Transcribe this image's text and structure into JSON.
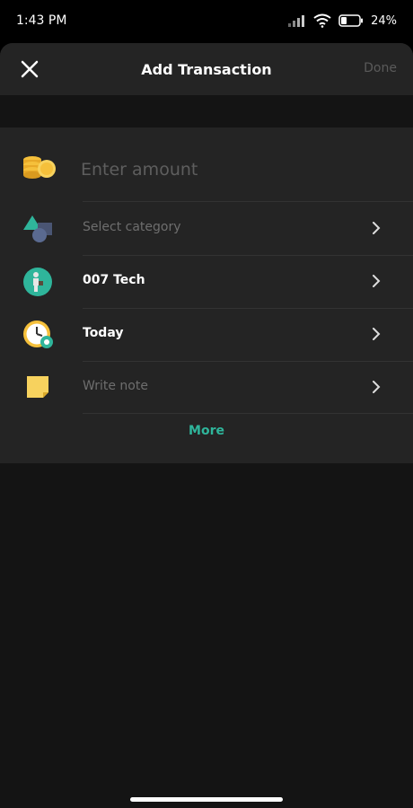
{
  "status_bar": {
    "time": "1:43 PM",
    "battery": "24%",
    "icons": [
      "signal-icon",
      "wifi-icon",
      "battery-icon"
    ]
  },
  "header": {
    "title": "Add Transaction",
    "done_label": "Done",
    "close_icon": "close-icon"
  },
  "form": {
    "amount_placeholder": "Enter amount",
    "amount_value": "",
    "rows": [
      {
        "id": "category",
        "label": "Select category",
        "state": "placeholder",
        "icon": "category-shapes-icon"
      },
      {
        "id": "wallet",
        "label": "007 Tech",
        "state": "value",
        "icon": "wallet-person-icon"
      },
      {
        "id": "date",
        "label": "Today",
        "state": "value",
        "icon": "clock-icon"
      },
      {
        "id": "note",
        "label": "Write note",
        "state": "placeholder",
        "icon": "note-icon"
      }
    ],
    "more_label": "More"
  },
  "colors": {
    "accent": "#2fb59b",
    "sheet_bg": "#141414",
    "card_bg": "#242424",
    "placeholder": "#6e6e6e"
  }
}
